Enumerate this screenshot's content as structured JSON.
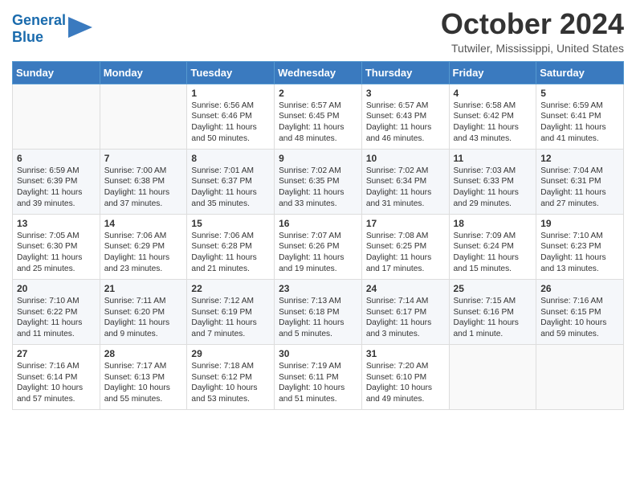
{
  "logo": {
    "line1": "General",
    "line2": "Blue"
  },
  "title": "October 2024",
  "location": "Tutwiler, Mississippi, United States",
  "days_of_week": [
    "Sunday",
    "Monday",
    "Tuesday",
    "Wednesday",
    "Thursday",
    "Friday",
    "Saturday"
  ],
  "weeks": [
    [
      {
        "day": "",
        "text": ""
      },
      {
        "day": "",
        "text": ""
      },
      {
        "day": "1",
        "text": "Sunrise: 6:56 AM\nSunset: 6:46 PM\nDaylight: 11 hours and 50 minutes."
      },
      {
        "day": "2",
        "text": "Sunrise: 6:57 AM\nSunset: 6:45 PM\nDaylight: 11 hours and 48 minutes."
      },
      {
        "day": "3",
        "text": "Sunrise: 6:57 AM\nSunset: 6:43 PM\nDaylight: 11 hours and 46 minutes."
      },
      {
        "day": "4",
        "text": "Sunrise: 6:58 AM\nSunset: 6:42 PM\nDaylight: 11 hours and 43 minutes."
      },
      {
        "day": "5",
        "text": "Sunrise: 6:59 AM\nSunset: 6:41 PM\nDaylight: 11 hours and 41 minutes."
      }
    ],
    [
      {
        "day": "6",
        "text": "Sunrise: 6:59 AM\nSunset: 6:39 PM\nDaylight: 11 hours and 39 minutes."
      },
      {
        "day": "7",
        "text": "Sunrise: 7:00 AM\nSunset: 6:38 PM\nDaylight: 11 hours and 37 minutes."
      },
      {
        "day": "8",
        "text": "Sunrise: 7:01 AM\nSunset: 6:37 PM\nDaylight: 11 hours and 35 minutes."
      },
      {
        "day": "9",
        "text": "Sunrise: 7:02 AM\nSunset: 6:35 PM\nDaylight: 11 hours and 33 minutes."
      },
      {
        "day": "10",
        "text": "Sunrise: 7:02 AM\nSunset: 6:34 PM\nDaylight: 11 hours and 31 minutes."
      },
      {
        "day": "11",
        "text": "Sunrise: 7:03 AM\nSunset: 6:33 PM\nDaylight: 11 hours and 29 minutes."
      },
      {
        "day": "12",
        "text": "Sunrise: 7:04 AM\nSunset: 6:31 PM\nDaylight: 11 hours and 27 minutes."
      }
    ],
    [
      {
        "day": "13",
        "text": "Sunrise: 7:05 AM\nSunset: 6:30 PM\nDaylight: 11 hours and 25 minutes."
      },
      {
        "day": "14",
        "text": "Sunrise: 7:06 AM\nSunset: 6:29 PM\nDaylight: 11 hours and 23 minutes."
      },
      {
        "day": "15",
        "text": "Sunrise: 7:06 AM\nSunset: 6:28 PM\nDaylight: 11 hours and 21 minutes."
      },
      {
        "day": "16",
        "text": "Sunrise: 7:07 AM\nSunset: 6:26 PM\nDaylight: 11 hours and 19 minutes."
      },
      {
        "day": "17",
        "text": "Sunrise: 7:08 AM\nSunset: 6:25 PM\nDaylight: 11 hours and 17 minutes."
      },
      {
        "day": "18",
        "text": "Sunrise: 7:09 AM\nSunset: 6:24 PM\nDaylight: 11 hours and 15 minutes."
      },
      {
        "day": "19",
        "text": "Sunrise: 7:10 AM\nSunset: 6:23 PM\nDaylight: 11 hours and 13 minutes."
      }
    ],
    [
      {
        "day": "20",
        "text": "Sunrise: 7:10 AM\nSunset: 6:22 PM\nDaylight: 11 hours and 11 minutes."
      },
      {
        "day": "21",
        "text": "Sunrise: 7:11 AM\nSunset: 6:20 PM\nDaylight: 11 hours and 9 minutes."
      },
      {
        "day": "22",
        "text": "Sunrise: 7:12 AM\nSunset: 6:19 PM\nDaylight: 11 hours and 7 minutes."
      },
      {
        "day": "23",
        "text": "Sunrise: 7:13 AM\nSunset: 6:18 PM\nDaylight: 11 hours and 5 minutes."
      },
      {
        "day": "24",
        "text": "Sunrise: 7:14 AM\nSunset: 6:17 PM\nDaylight: 11 hours and 3 minutes."
      },
      {
        "day": "25",
        "text": "Sunrise: 7:15 AM\nSunset: 6:16 PM\nDaylight: 11 hours and 1 minute."
      },
      {
        "day": "26",
        "text": "Sunrise: 7:16 AM\nSunset: 6:15 PM\nDaylight: 10 hours and 59 minutes."
      }
    ],
    [
      {
        "day": "27",
        "text": "Sunrise: 7:16 AM\nSunset: 6:14 PM\nDaylight: 10 hours and 57 minutes."
      },
      {
        "day": "28",
        "text": "Sunrise: 7:17 AM\nSunset: 6:13 PM\nDaylight: 10 hours and 55 minutes."
      },
      {
        "day": "29",
        "text": "Sunrise: 7:18 AM\nSunset: 6:12 PM\nDaylight: 10 hours and 53 minutes."
      },
      {
        "day": "30",
        "text": "Sunrise: 7:19 AM\nSunset: 6:11 PM\nDaylight: 10 hours and 51 minutes."
      },
      {
        "day": "31",
        "text": "Sunrise: 7:20 AM\nSunset: 6:10 PM\nDaylight: 10 hours and 49 minutes."
      },
      {
        "day": "",
        "text": ""
      },
      {
        "day": "",
        "text": ""
      }
    ]
  ]
}
